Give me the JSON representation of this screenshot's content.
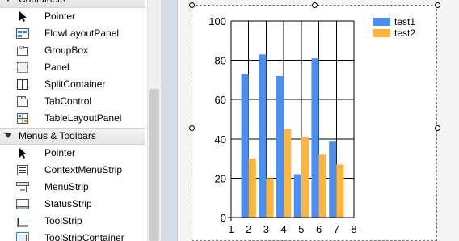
{
  "toolbox": {
    "sections": [
      {
        "name": "Containers",
        "items": [
          {
            "label": "Pointer",
            "icon": "pointer-icon"
          },
          {
            "label": "FlowLayoutPanel",
            "icon": "flowlayoutpanel-icon"
          },
          {
            "label": "GroupBox",
            "icon": "groupbox-icon"
          },
          {
            "label": "Panel",
            "icon": "panel-icon"
          },
          {
            "label": "SplitContainer",
            "icon": "splitcontainer-icon"
          },
          {
            "label": "TabControl",
            "icon": "tabcontrol-icon"
          },
          {
            "label": "TableLayoutPanel",
            "icon": "tablelayoutpanel-icon"
          }
        ]
      },
      {
        "name": "Menus & Toolbars",
        "items": [
          {
            "label": "Pointer",
            "icon": "pointer-icon"
          },
          {
            "label": "ContextMenuStrip",
            "icon": "contextmenustrip-icon"
          },
          {
            "label": "MenuStrip",
            "icon": "menustrip-icon"
          },
          {
            "label": "StatusStrip",
            "icon": "statusstrip-icon"
          },
          {
            "label": "ToolStrip",
            "icon": "toolstrip-icon"
          },
          {
            "label": "ToolStripContainer",
            "icon": "toolstripcontainer-icon"
          }
        ]
      }
    ]
  },
  "chart_data": {
    "type": "bar",
    "x": [
      2,
      3,
      4,
      5,
      6,
      7
    ],
    "series": [
      {
        "name": "test1",
        "values": [
          73,
          83,
          72,
          22,
          81,
          39
        ],
        "color": "#4a8ff0"
      },
      {
        "name": "test2",
        "values": [
          30,
          20,
          45,
          41,
          32,
          27
        ],
        "color": "#ffb43c"
      }
    ],
    "xlim": [
      1,
      8
    ],
    "ylim": [
      0,
      100
    ],
    "xticks": [
      "1",
      "2",
      "3",
      "4",
      "5",
      "6",
      "7",
      "8"
    ],
    "yticks": [
      "0",
      "20",
      "40",
      "60",
      "80",
      "100"
    ],
    "grid": true,
    "legend": "top-right"
  }
}
